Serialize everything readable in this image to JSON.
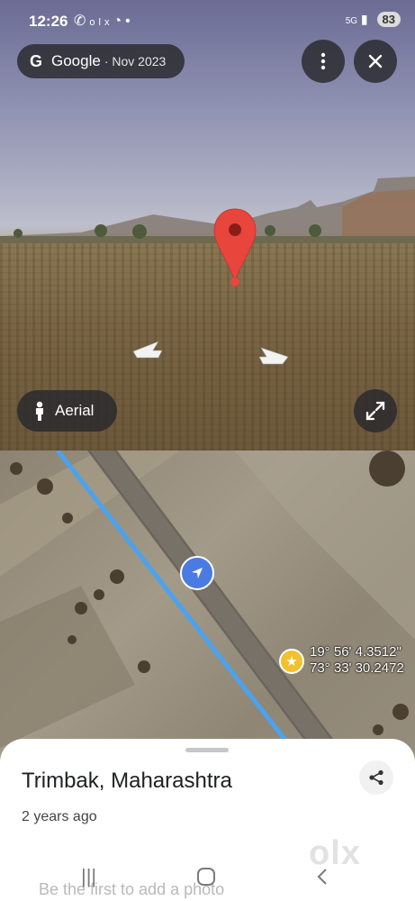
{
  "status_bar": {
    "time": "12:26",
    "notification_icons": [
      "whatsapp-icon",
      "olx-icon",
      "messenger-icon",
      "dot-icon"
    ],
    "battery": "83"
  },
  "imagery_chip": {
    "brand": "Google",
    "date": "· Nov 2023"
  },
  "aerial_button": {
    "label": "Aerial"
  },
  "location": {
    "coordinates_line1": "19° 56' 4.3512\"",
    "coordinates_line2": "73° 33' 30.2472"
  },
  "sheet": {
    "title": "Trimbak, Maharashtra",
    "timestamp": "2 years ago",
    "add_photo_hint": "Be the first to add a photo"
  },
  "watermark": "olx",
  "colors": {
    "route_line": "#4aa3ef",
    "pin_red": "#e8453c",
    "nav_pin_blue": "#4a7be3",
    "star_yellow": "#f2c12e"
  }
}
